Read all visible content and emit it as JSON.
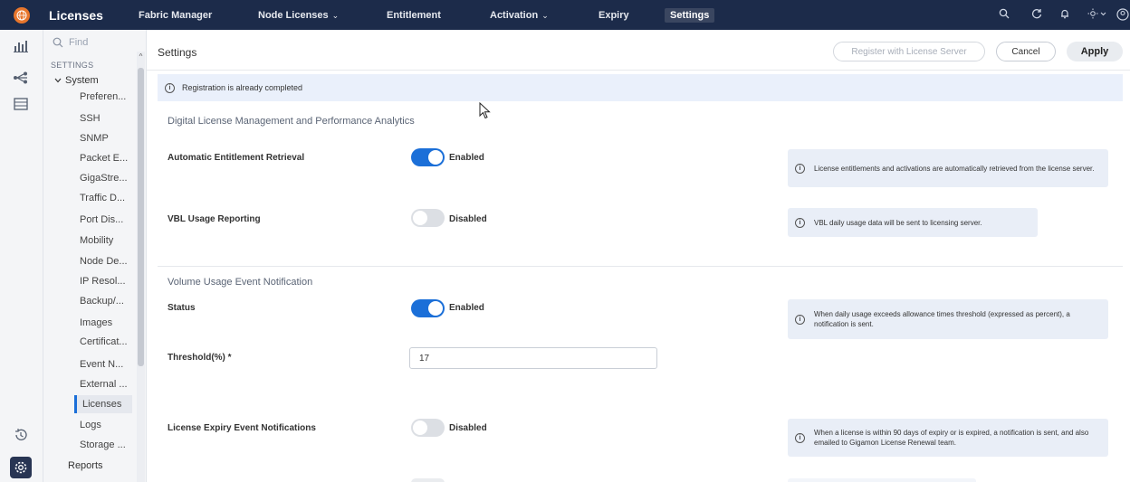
{
  "header": {
    "app_title": "Licenses",
    "nav": [
      {
        "label": "Fabric Manager",
        "dropdown": false
      },
      {
        "label": "Node Licenses",
        "dropdown": true
      },
      {
        "label": "Entitlement",
        "dropdown": false
      },
      {
        "label": "Activation",
        "dropdown": true
      },
      {
        "label": "Expiry",
        "dropdown": false
      },
      {
        "label": "Settings",
        "dropdown": false,
        "active": true
      }
    ],
    "icons": [
      "search-icon",
      "refresh-icon",
      "bell-icon",
      "theme-icon",
      "user-icon"
    ],
    "chevron": "⌄"
  },
  "rail": {
    "icons": [
      "dashboard-icon",
      "topology-icon",
      "inventory-icon",
      "history-icon",
      "settings-icon"
    ]
  },
  "tree": {
    "find_placeholder": "Find",
    "section": "SETTINGS",
    "group": "System",
    "items": [
      "Preferen...",
      "SSH",
      "SNMP",
      "Packet E...",
      "GigaStre...",
      "Traffic D...",
      "Port Dis...",
      "Mobility",
      "Node De...",
      "IP Resol...",
      "Backup/...",
      "Images",
      "Certificat...",
      "Event N...",
      "External ...",
      "Licenses",
      "Logs",
      "Storage ..."
    ],
    "selected": "Licenses",
    "reports": "Reports"
  },
  "page": {
    "title": "Settings",
    "buttons": {
      "register": "Register with License Server",
      "cancel": "Cancel",
      "apply": "Apply"
    },
    "banner": "Registration is already completed",
    "section1": "Digital License Management and Performance Analytics",
    "section2": "Volume Usage Event Notification",
    "rows": {
      "auto_entitlement": {
        "label": "Automatic Entitlement Retrieval",
        "state": "Enabled",
        "on": true,
        "info": "License entitlements and activations are automatically retrieved from the license server."
      },
      "vbl_usage": {
        "label": "VBL Usage Reporting",
        "state": "Disabled",
        "on": false,
        "info": "VBL daily usage data will be sent to licensing server."
      },
      "status": {
        "label": "Status",
        "state": "Enabled",
        "on": true,
        "info": "When daily usage exceeds allowance times threshold (expressed as percent), a notification is sent."
      },
      "threshold": {
        "label": "Threshold(%) *",
        "value": "17"
      },
      "expiry": {
        "label": "License Expiry Event Notifications",
        "state": "Disabled",
        "on": false,
        "info": "When a license is within 90 days of expiry or is expired, a notification is sent, and also emailed to Gigamon License Renewal team."
      }
    }
  },
  "colors": {
    "topbar": "#1c2b4a",
    "accent": "#1b6fd8",
    "logo": "#e8762c",
    "info_bg": "#e9eef7"
  }
}
